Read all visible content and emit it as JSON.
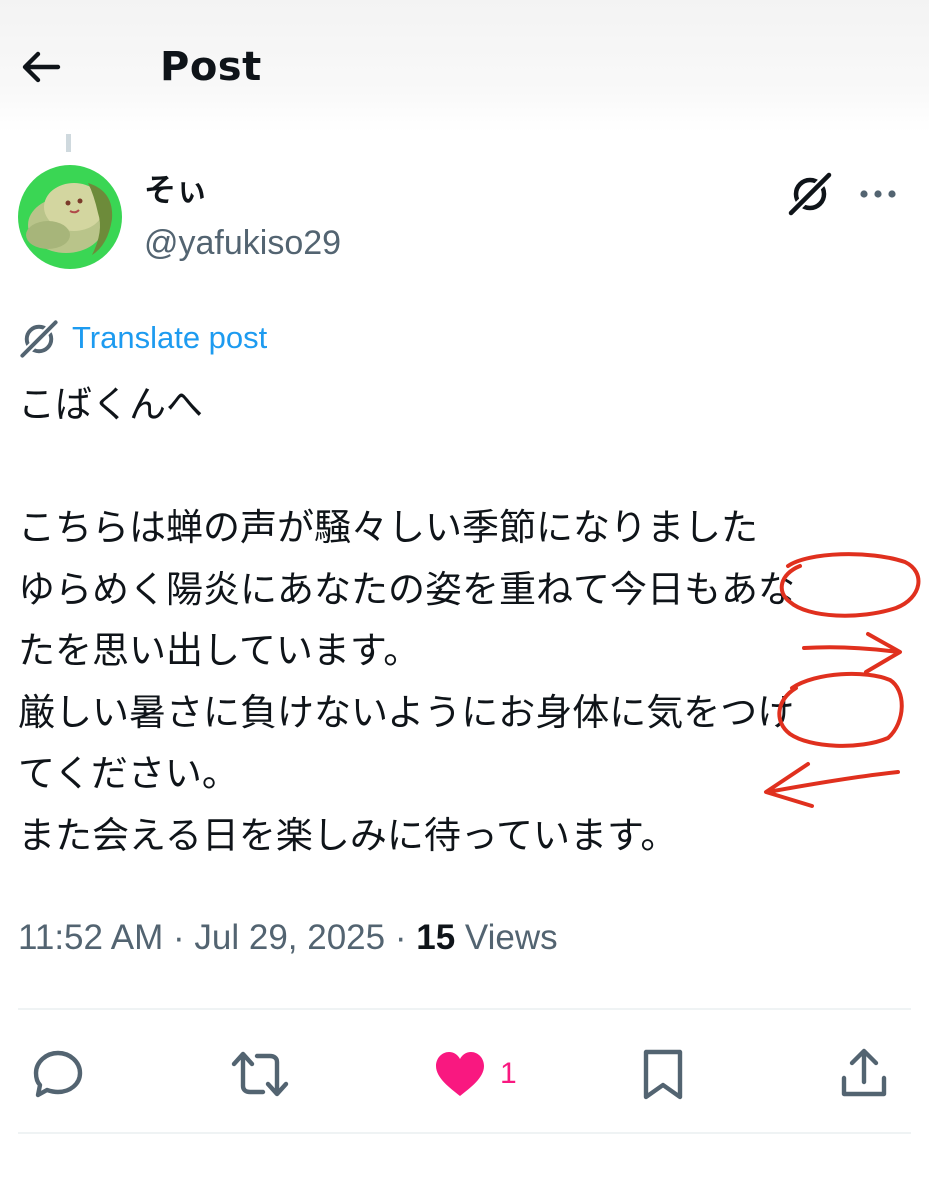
{
  "header": {
    "back_icon": "arrow-left-icon",
    "title": "Post"
  },
  "author": {
    "display_name": "そぃ",
    "handle": "@yafukiso29",
    "avatar_icon": "avatar-image"
  },
  "toolbar_icons": [
    "grok-icon",
    "more-horizontal-icon"
  ],
  "translate": {
    "icon": "grok-icon",
    "label": "Translate post"
  },
  "post": {
    "text": "こばくんへ\n\nこちらは蝉の声が騒々しい季節になりました\nゆらめく陽炎にあなたの姿を重ねて今日もあな\nたを思い出しています。\n厳しい暑さに負けないようにお身体に気をつけ\nてください。\nまた会える日を楽しみに待っています。"
  },
  "meta": {
    "time": "11:52 AM",
    "separator": "·",
    "date": "Jul 29, 2025",
    "views_count": "15",
    "views_label": "Views"
  },
  "actions": {
    "reply_icon": "reply-icon",
    "repost_icon": "repost-icon",
    "like_icon": "heart-filled-icon",
    "like_count": "1",
    "bookmark_icon": "bookmark-icon",
    "share_icon": "share-icon"
  },
  "colors": {
    "link_blue": "#1d9bf0",
    "muted_gray": "#536471",
    "like_pink": "#f91880",
    "annotation_red": "#e0301e",
    "avatar_green": "#3ad654"
  }
}
